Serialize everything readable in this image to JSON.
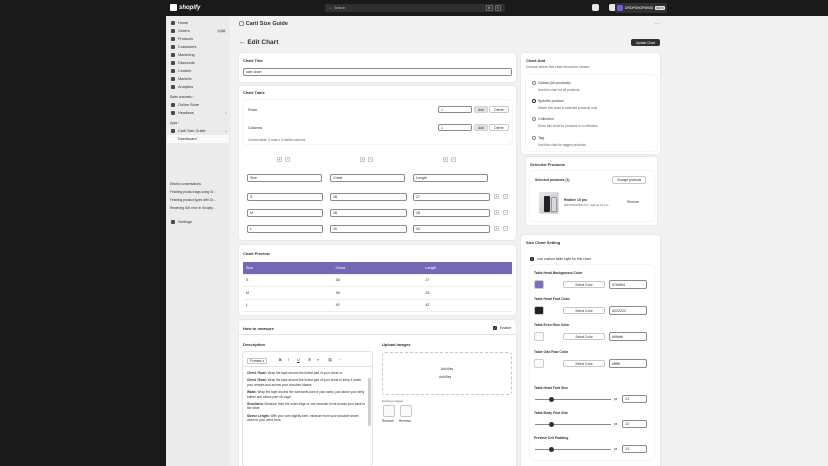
{
  "topbar": {
    "logo_text": "shopify",
    "search_placeholder": "Search",
    "shortcut_keys": [
      "⌘",
      "K"
    ],
    "store_name": "DROPSHOPMIND",
    "store_badge": "DEVS"
  },
  "sidebar": {
    "items": [
      {
        "label": "Home",
        "icon": "home-icon"
      },
      {
        "label": "Orders",
        "icon": "orders-icon",
        "badge": "1,000"
      },
      {
        "label": "Products",
        "icon": "products-icon"
      },
      {
        "label": "Customers",
        "icon": "customers-icon"
      },
      {
        "label": "Marketing",
        "icon": "marketing-icon"
      },
      {
        "label": "Discounts",
        "icon": "discounts-icon"
      },
      {
        "label": "Content",
        "icon": "content-icon"
      },
      {
        "label": "Markets",
        "icon": "markets-icon"
      },
      {
        "label": "Analytics",
        "icon": "analytics-icon"
      }
    ],
    "sales_channels_label": "Sales channels",
    "channels": [
      {
        "label": "Online Store"
      },
      {
        "label": "Headless"
      }
    ],
    "apps_label": "Apps",
    "apps": [
      {
        "label": "Carti Size Guide"
      },
      {
        "label": "Dashboard"
      }
    ],
    "recent_label": "Electric conversations",
    "recent": [
      {
        "label": "Fetching product tags using Gr..."
      },
      {
        "label": "Fetching product types with Gr..."
      },
      {
        "label": "Receiving 404 error in Shopify..."
      }
    ],
    "settings_label": "Settings"
  },
  "app_header": {
    "title": "Carti Size Guide",
    "more": "⋯"
  },
  "page": {
    "title": "Edit Chart",
    "update_button": "Update Chart"
  },
  "chart_title": {
    "heading": "Chart Title",
    "value": "size-chart"
  },
  "chart_table": {
    "heading": "Chart Table",
    "rows_label": "Rows",
    "rows_value": "1",
    "columns_label": "Columns",
    "columns_value": "1",
    "add_label": "Add",
    "delete_label": "Delete",
    "current_table_text": "Current table: 3 rows x 3 visible columns",
    "plus": "+",
    "minus": "−",
    "header_cells": [
      "Size",
      "Chest",
      "Length"
    ],
    "rows": [
      [
        "S",
        "38",
        "27"
      ],
      [
        "M",
        "38",
        "28"
      ],
      [
        "L",
        "40",
        "42"
      ]
    ]
  },
  "chart_preview": {
    "heading": "Chart Preview",
    "headers": [
      "Size",
      "Chest",
      "Length"
    ],
    "rows": [
      [
        "S",
        "38",
        "27"
      ],
      [
        "M",
        "38",
        "28"
      ],
      [
        "L",
        "40",
        "42"
      ]
    ]
  },
  "measure": {
    "heading": "How to measure",
    "enable_label": "Enable",
    "description_label": "Description",
    "format_label": "Formats",
    "bold": "B",
    "italic": "I",
    "underline": "U",
    "paragraphs": [
      {
        "term": "Chest / Bust:",
        "text": "Wrap the tape around the fullest part of your chest or"
      },
      {
        "term": "Chest / Bust:",
        "text": "Wrap the tape around the fullest part of your chest to keep it under your armpits and across your shoulder blades."
      },
      {
        "term": "Waist:",
        "text": "Wrap the tape around the narrowest part of your waist, just above your belly button and below your rib cage."
      },
      {
        "term": "Shoulders:",
        "text": "Measure from the outer edge of one shoulder bone across your back to the other."
      },
      {
        "term": "Sleeve Length:",
        "text": "With your arm slightly bent, measure from your shoulder seam down to your wrist bone."
      }
    ],
    "upload_label": "Upload Images",
    "add_files": "Add files",
    "add_files_sub": "Add files",
    "existing_label": "Existing images",
    "remove_label": "Remove"
  },
  "chart_add": {
    "heading": "Chart Add",
    "subheading": "Choose where this chart should be shown.",
    "options": [
      {
        "title": "Global (All products)",
        "desc": "Use this chart for all products.",
        "selected": false
      },
      {
        "title": "Specific product",
        "desc": "Attach this chart to selected products only.",
        "selected": true
      },
      {
        "title": "Collection",
        "desc": "Show this chart for products in a collection.",
        "selected": false
      },
      {
        "title": "Tag",
        "desc": "Use this chart for tagged products.",
        "selected": false
      }
    ]
  },
  "selected_products": {
    "heading": "Selected Products",
    "count_label": "Selected products (1)",
    "change_button": "Change products",
    "product_name": "Realme 15 pro",
    "product_sub": "DROPSHOPM ID | realme 15 pro",
    "remove_button": "Remove"
  },
  "size_setting": {
    "heading": "Size Chart Setting",
    "custom_style_label": "Use custom table style for this chart",
    "select_color": "Select Color",
    "colors": [
      {
        "label": "Table Head Background Color",
        "hex": "#7b6fbd",
        "value": "#7b6fbd"
      },
      {
        "label": "Table Head Font Color",
        "hex": "#222222",
        "value": "#222222"
      },
      {
        "label": "Table Even Row Color",
        "hex": "#f9fafb",
        "value": "#f9fafb"
      },
      {
        "label": "Table Odd Row Color",
        "hex": "#ffffff",
        "value": "#ffffff"
      }
    ],
    "sliders": [
      {
        "label": "Table Head Font Size",
        "value": "13",
        "unit": "px",
        "fraction": 0.22
      },
      {
        "label": "Table Body Font Size",
        "value": "13",
        "unit": "px",
        "fraction": 0.22
      },
      {
        "label": "Preview Cell Padding",
        "value": "13",
        "unit": "px",
        "fraction": 0.22
      }
    ]
  }
}
